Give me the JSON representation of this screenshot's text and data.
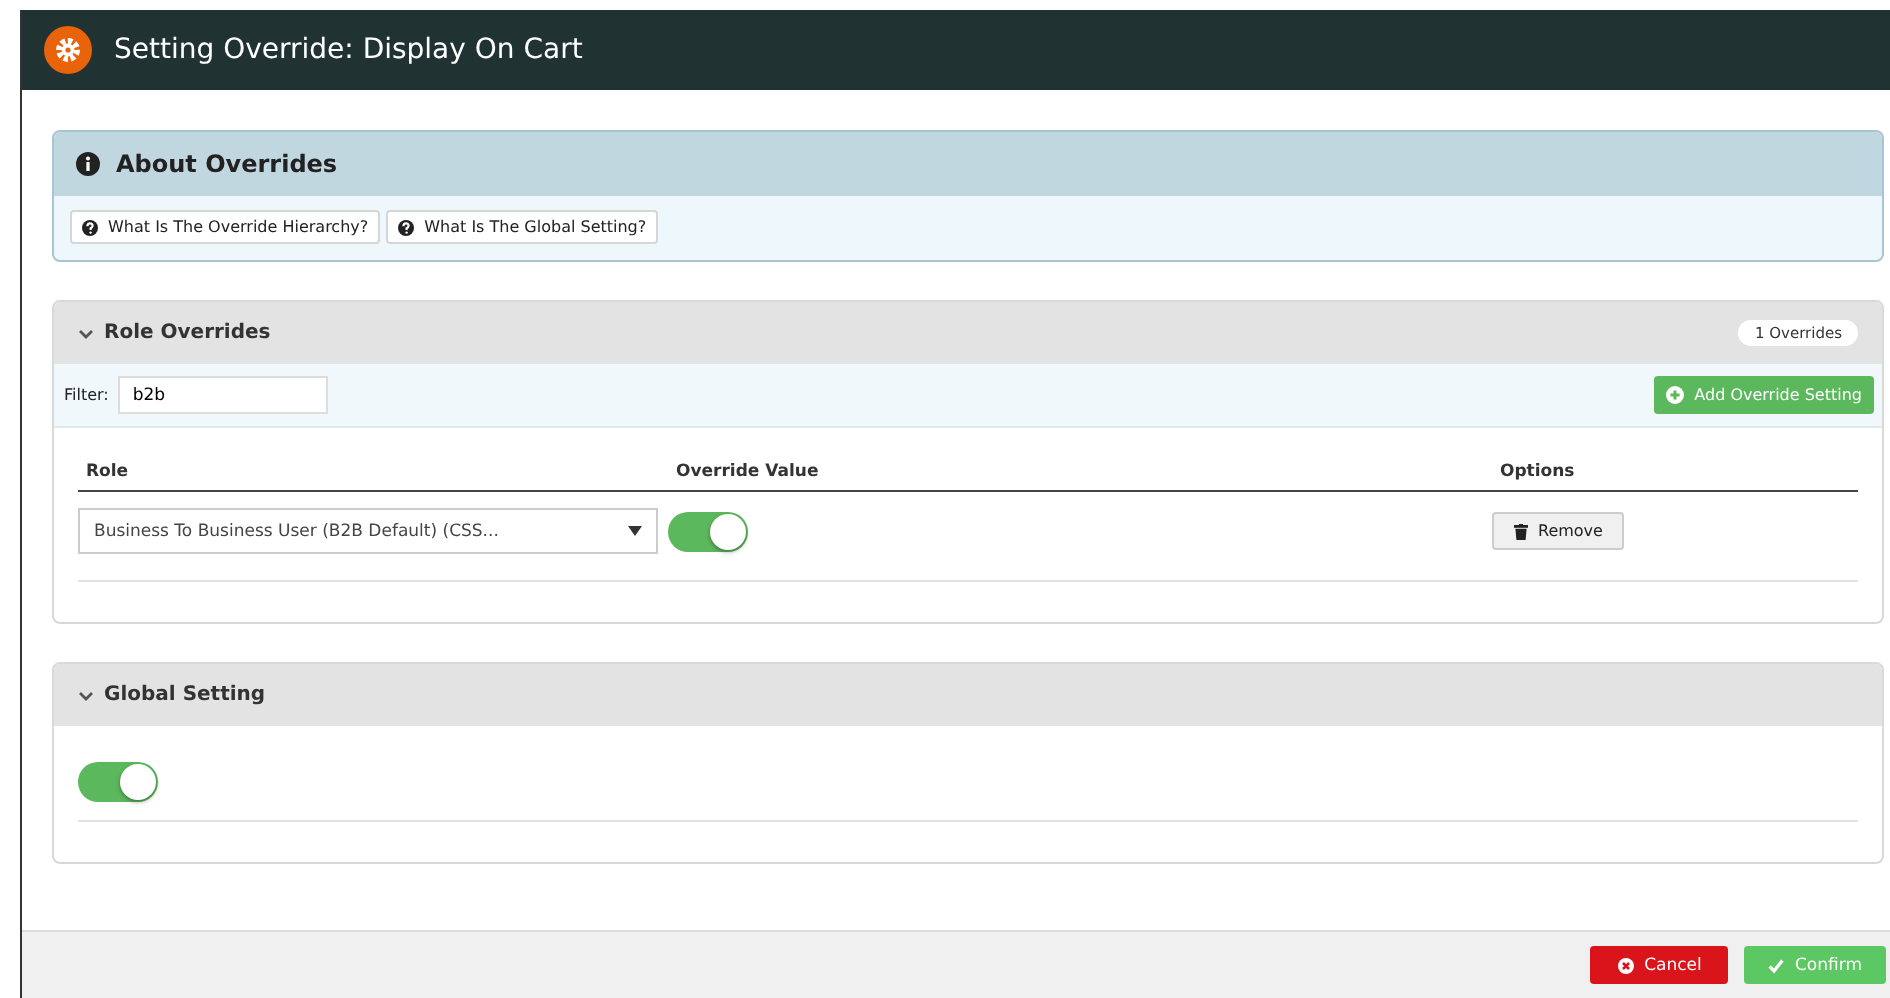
{
  "window": {
    "title": "Setting Override: Display On Cart"
  },
  "about": {
    "title": "About Overrides",
    "buttons": [
      "What Is The Override Hierarchy?",
      "What Is The Global Setting?"
    ]
  },
  "role_overrides": {
    "title": "Role Overrides",
    "expanded": true,
    "count_badge": "1 Overrides",
    "filter": {
      "label": "Filter:",
      "value": "b2b"
    },
    "add_button": "Add Override Setting",
    "columns": [
      "Role",
      "Override Value",
      "Options"
    ],
    "rows": [
      {
        "role": "Business To Business User (B2B Default) (CSS...",
        "on": true,
        "remove_button": "Remove"
      }
    ]
  },
  "global_setting": {
    "title": "Global Setting",
    "expanded": true,
    "on": true
  },
  "footer": {
    "buttons": [
      {
        "kind": "cancel",
        "label": "Cancel"
      },
      {
        "kind": "confirm",
        "label": "Confirm"
      }
    ]
  }
}
